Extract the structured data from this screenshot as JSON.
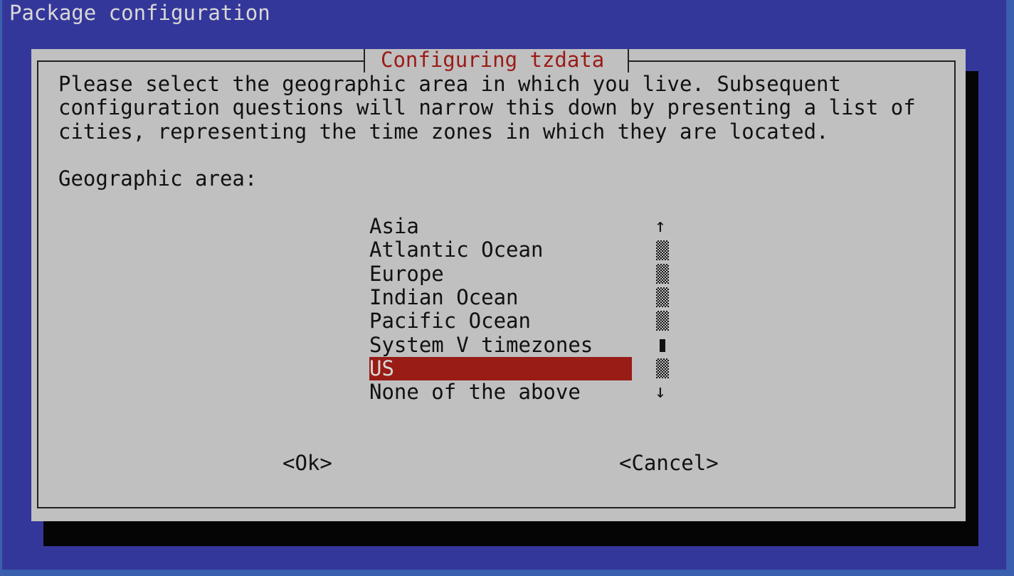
{
  "window_title": "Package configuration",
  "dialog": {
    "title": "Configuring tzdata",
    "description": [
      "Please select the geographic area in which you live. Subsequent",
      "configuration questions will narrow this down by presenting a list of",
      "cities, representing the time zones in which they are located."
    ],
    "prompt": "Geographic area:",
    "options": [
      "Asia",
      "Atlantic Ocean",
      "Europe",
      "Indian Ocean",
      "Pacific Ocean",
      "System V timezones",
      "US",
      "None of the above"
    ],
    "selected": "US",
    "scroll_up": "↑",
    "scroll_down": "↓",
    "ok_label": "<Ok>",
    "cancel_label": "<Cancel>"
  },
  "colors": {
    "background": "#34379a",
    "dialog": "#c0c0c0",
    "highlight": "#991c16",
    "title": "#9b1b16"
  }
}
